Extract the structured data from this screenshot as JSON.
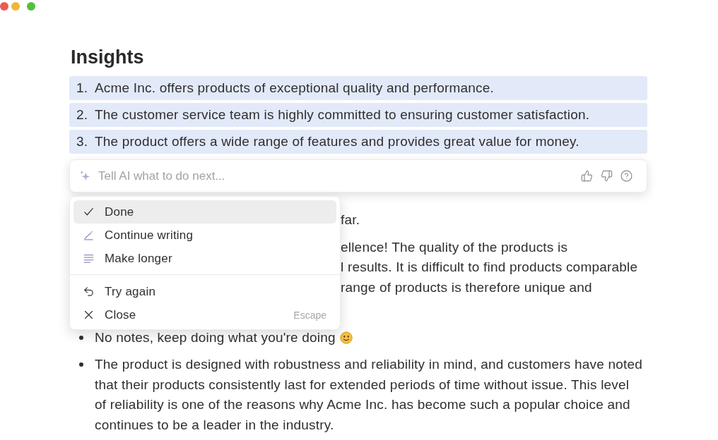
{
  "insights": {
    "heading": "Insights",
    "items": [
      {
        "number": "1.",
        "text": "Acme Inc. offers products of exceptional quality and performance.",
        "selected": true
      },
      {
        "number": "2.",
        "text": "The customer service team is highly committed to ensuring customer satisfaction.",
        "selected": true
      },
      {
        "number": "3.",
        "text": "The product offers a wide range of features and provides great value for money.",
        "selected": true
      }
    ]
  },
  "ai_prompt": {
    "placeholder": "Tell AI what to do next..."
  },
  "ai_menu": {
    "groups": [
      {
        "items": [
          {
            "label": "Done",
            "selected": true
          },
          {
            "label": "Continue writing",
            "selected": false
          },
          {
            "label": "Make longer",
            "selected": false
          }
        ]
      },
      {
        "items": [
          {
            "label": "Try again",
            "selected": false
          },
          {
            "label": "Close",
            "selected": false,
            "shortcut": "Escape"
          }
        ]
      }
    ]
  },
  "feedback": {
    "paragraphs": [
      {
        "lines": [
          "far."
        ]
      },
      {
        "lines": [
          "ellence! The quality of the products is",
          "l results. It is difficult to find products comparable",
          "range of products is therefore unique and"
        ]
      }
    ],
    "bullets": [
      {
        "text": "No notes, keep doing what you're doing",
        "emoji": true
      },
      {
        "text": "The product is designed with robustness and reliability in mind, and customers have noted that their products consistently last for extended periods of time without issue. This level of reliability is one of the reasons why Acme Inc. has become such a popular choice and continues to be a leader in the industry.",
        "emoji": false
      }
    ]
  }
}
